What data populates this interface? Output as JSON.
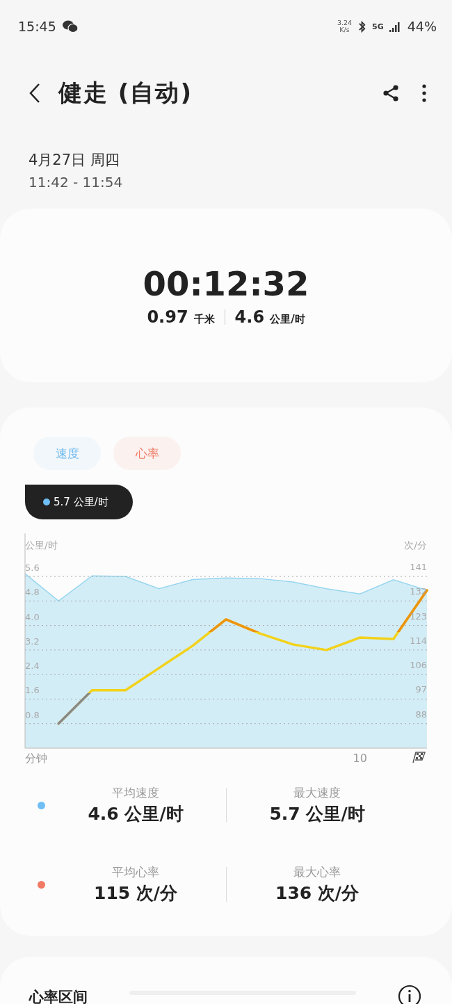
{
  "status_bar": {
    "time": "15:45",
    "net_speed_value": "3.24",
    "net_speed_unit": "K/s",
    "network": "5G",
    "battery": "44%"
  },
  "header": {
    "title": "健走 (自动)"
  },
  "session": {
    "date": "4月27日 周四",
    "time_range": "11:42 - 11:54"
  },
  "summary": {
    "duration": "00:12:32",
    "distance_value": "0.97",
    "distance_unit": "千米",
    "speed_value": "4.6",
    "speed_unit": "公里/时"
  },
  "chart_tabs": [
    {
      "selected": true,
      "color": "#6fb9ee"
    },
    {
      "selected": true,
      "color": "#f07a63"
    }
  ],
  "tooltip": {
    "text": "5.7 公里/时",
    "color": "#6fbff5"
  },
  "chart": {
    "x_axis_label": "分钟",
    "charts": [
      {
        "chart_data": {
          "type": "area",
          "ylabel": "公里/时",
          "categories": [
            null,
            null,
            null,
            null,
            null,
            null,
            null,
            null,
            null,
            null,
            "10",
            null,
            null
          ],
          "ylim": [
            0,
            7
          ],
          "yticks": [
            0.8,
            1.6,
            2.4,
            3.2,
            {
              "value": 4.0,
              "label": "4.0"
            },
            4.8,
            5.6
          ],
          "grid": true,
          "series": [
            {
              "name": "速度",
              "color": "#97d6ef",
              "values": [
                5.69,
                4.8,
                5.62,
                5.6,
                5.2,
                5.5,
                5.55,
                5.53,
                5.42,
                5.2,
                5.03,
                5.49,
                5.15
              ]
            }
          ]
        }
      },
      {
        "chart_data": {
          "type": "line",
          "ylabel": "次/分",
          "ylim": [
            88,
            141
          ],
          "categories": [
            null,
            null,
            null,
            null,
            null,
            null,
            null,
            null,
            null,
            null,
            null,
            null,
            null
          ],
          "yticks": [
            {
              "value": 88,
              "label": "88"
            },
            {
              "value": 96.83,
              "label": "97"
            },
            {
              "value": 105.67,
              "label": "106"
            },
            {
              "value": 114.5,
              "label": "114"
            },
            {
              "value": 123.33,
              "label": "123"
            },
            {
              "value": 132.17,
              "label": "132"
            },
            {
              "value": 141,
              "label": "141"
            }
          ],
          "series": [
            {
              "name": "心率",
              "color": "#f2d21b",
              "values": [
                null,
                88,
                100,
                100,
                108,
                116,
                125.5,
                120.5,
                116.5,
                114.5,
                119,
                118.5,
                136
              ]
            }
          ]
        }
      }
    ]
  },
  "stats": [
    {
      "color": "#6fbff5",
      "items": [
        {
          "label": "平均速度",
          "value": "4.6 公里/时"
        },
        {
          "label": "最大速度",
          "value": "5.7 公里/时"
        }
      ]
    },
    {
      "color": "#f07a63",
      "items": [
        {
          "label": "平均心率",
          "value": "115 次/分"
        },
        {
          "label": "最大心率",
          "value": "136 次/分"
        }
      ]
    }
  ],
  "heart_rate_zones": {
    "title": "心率区间"
  }
}
